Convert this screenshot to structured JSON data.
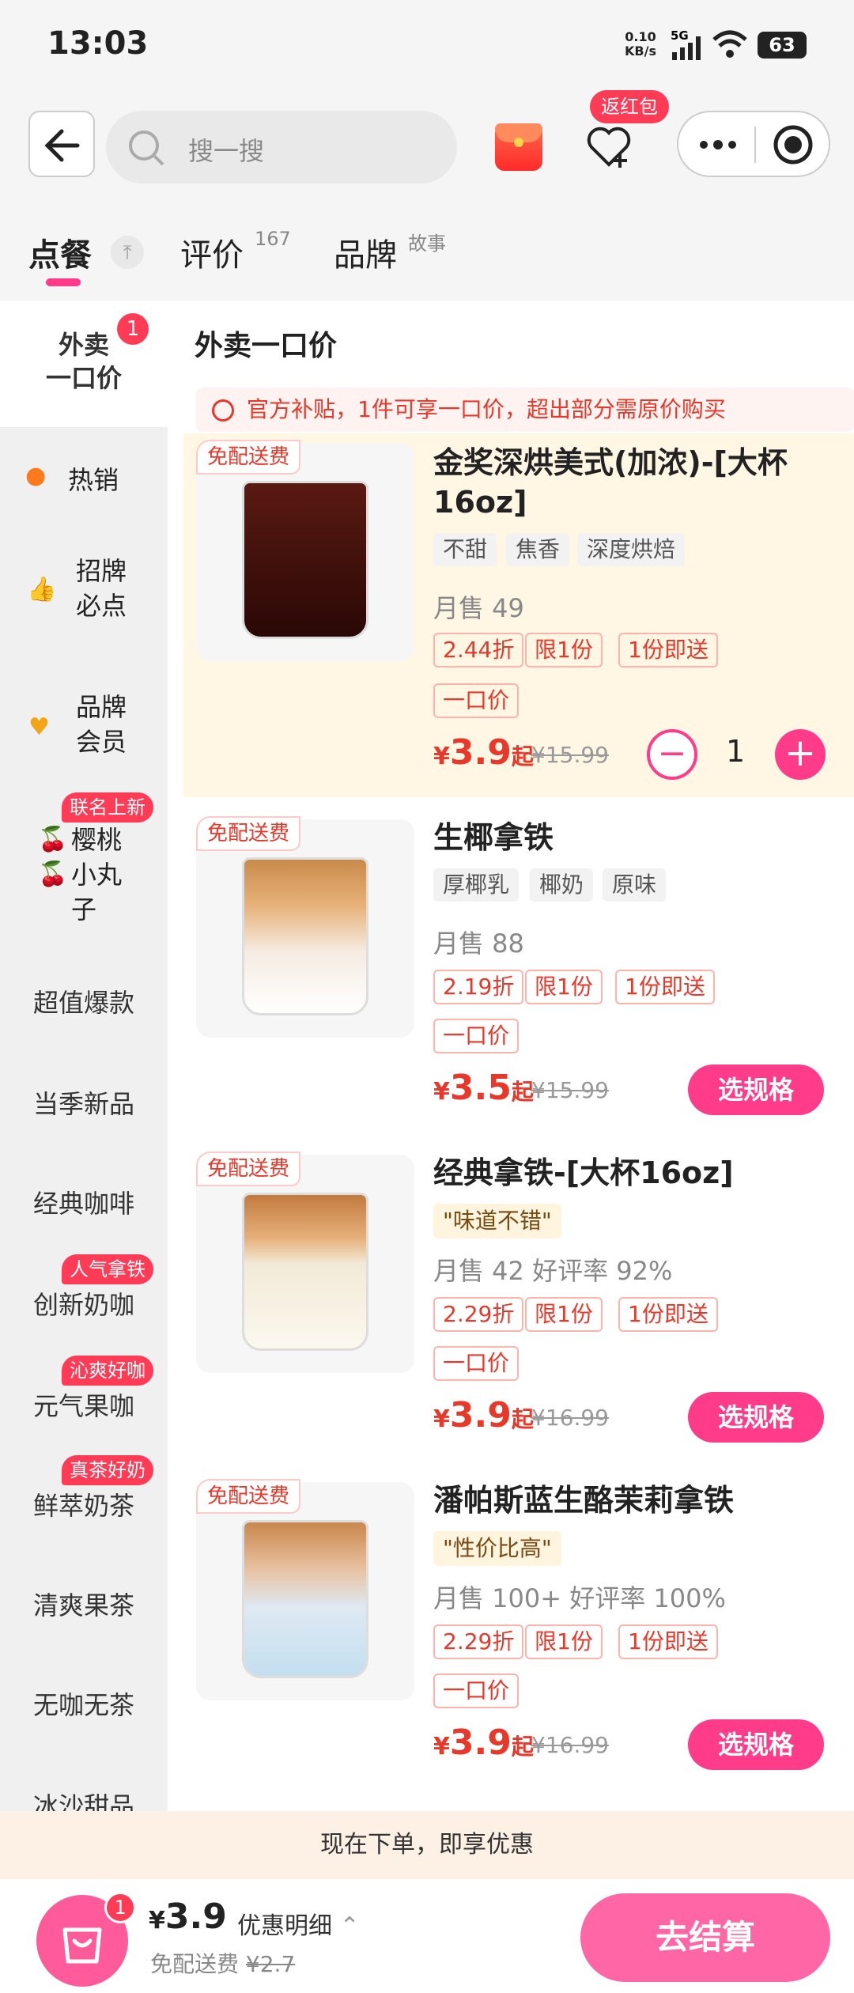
{
  "status": {
    "time": "13:03",
    "net_speed": "0.10",
    "net_unit": "KB/s",
    "network": "5G",
    "battery": "63"
  },
  "header": {
    "search_placeholder": "搜一搜",
    "fav_badge": "返红包"
  },
  "tabs": [
    {
      "label": "点餐"
    },
    {
      "label": "评价",
      "sup": "167"
    },
    {
      "label": "品牌",
      "sup": "故事"
    }
  ],
  "sidebar": {
    "active": {
      "line1": "外卖",
      "line2": "一口价",
      "count": "1"
    },
    "items": [
      {
        "label": "热销",
        "icon": "flame-icon"
      },
      {
        "label1": "招牌",
        "label2": "必点",
        "icon": "thumbs-up-icon"
      },
      {
        "label1": "品牌",
        "label2": "会员",
        "icon": "member-heart-icon"
      },
      {
        "badge": "联名上新",
        "label1": "樱桃",
        "label2": "小丸",
        "label3": "子",
        "icon": "cherry-icon"
      },
      {
        "label": "超值爆款"
      },
      {
        "label": "当季新品"
      },
      {
        "label": "经典咖啡"
      },
      {
        "badge": "人气拿铁",
        "label": "创新奶咖"
      },
      {
        "badge": "沁爽好咖",
        "label": "元气果咖"
      },
      {
        "badge": "真茶好奶",
        "label": "鲜萃奶茶"
      },
      {
        "label": "清爽果茶"
      },
      {
        "label": "无咖无茶"
      },
      {
        "label": "冰沙甜品"
      }
    ]
  },
  "main": {
    "section_title": "外卖一口价",
    "notice": "官方补贴，1件可享一口价，超出部分需原价购买",
    "products": [
      {
        "free_tag": "免配送费",
        "name": "金奖深烘美式(加浓)-[大杯16oz]",
        "attrs": [
          "不甜",
          "焦香",
          "深度烘焙"
        ],
        "sales": "月售 49",
        "promos": [
          "2.44折",
          "限1份",
          "1份即送"
        ],
        "one_price": "一口价",
        "price_cur": "¥",
        "price": "3.9",
        "price_suffix": "起",
        "old_price": "¥15.99",
        "qty": "1"
      },
      {
        "free_tag": "免配送费",
        "name": "生椰拿铁",
        "attrs": [
          "厚椰乳",
          "椰奶",
          "原味"
        ],
        "sales": "月售 88",
        "promos": [
          "2.19折",
          "限1份",
          "1份即送"
        ],
        "one_price": "一口价",
        "price_cur": "¥",
        "price": "3.5",
        "price_suffix": "起",
        "old_price": "¥15.99",
        "button": "选规格"
      },
      {
        "free_tag": "免配送费",
        "name": "经典拿铁-[大杯16oz]",
        "highlight": "\"味道不错\"",
        "sales": "月售 42 好评率 92%",
        "promos": [
          "2.29折",
          "限1份",
          "1份即送"
        ],
        "one_price": "一口价",
        "price_cur": "¥",
        "price": "3.9",
        "price_suffix": "起",
        "old_price": "¥16.99",
        "button": "选规格"
      },
      {
        "free_tag": "免配送费",
        "name": "潘帕斯蓝生酪茉莉拿铁",
        "highlight": "\"性价比高\"",
        "sales": "月售 100+ 好评率 100%",
        "promos": [
          "2.29折",
          "限1份",
          "1份即送"
        ],
        "one_price": "一口价",
        "price_cur": "¥",
        "price": "3.9",
        "price_suffix": "起",
        "old_price": "¥16.99",
        "button": "选规格"
      }
    ]
  },
  "bottom": {
    "banner": "现在下单，即享优惠",
    "cart_count": "1",
    "total_cur": "¥",
    "total": "3.9",
    "detail": "优惠明细",
    "delivery_label": "免配送费",
    "delivery_old": "¥2.7",
    "checkout": "去结算"
  },
  "colors": {
    "accent": "#ff3b8a",
    "price": "#e8382a",
    "badge": "#ff3b56"
  }
}
